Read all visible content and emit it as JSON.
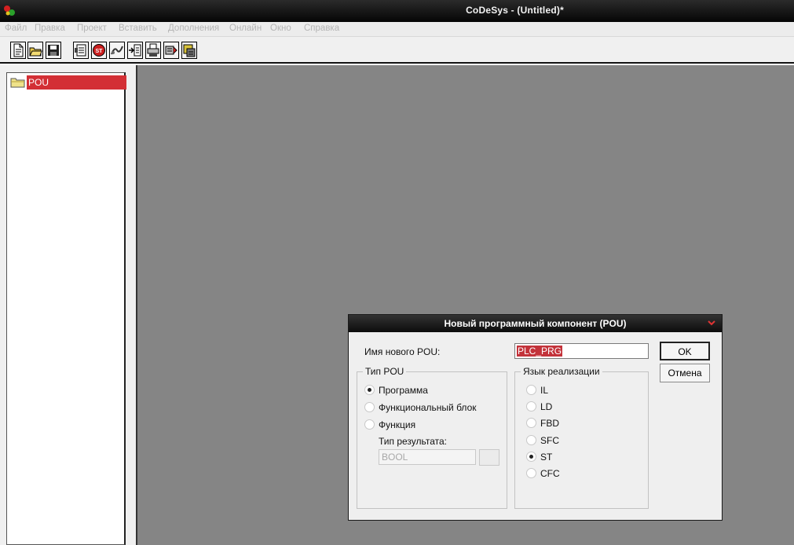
{
  "window": {
    "title": "CoDeSys - (Untitled)*"
  },
  "menu": [
    {
      "label": "Файл"
    },
    {
      "label": "Правка"
    },
    {
      "label": "Проект"
    },
    {
      "label": "Вставить"
    },
    {
      "label": "Дополнения"
    },
    {
      "label": "Онлайн"
    },
    {
      "label": "Окно"
    },
    {
      "label": "Справка"
    }
  ],
  "toolbar": {
    "icons": [
      "new-file-icon",
      "open-folder-icon",
      "save-icon",
      "pou-icon",
      "stop-icon",
      "connect-icon",
      "step-icon",
      "print-icon",
      "login-icon",
      "download-icon"
    ]
  },
  "tree": {
    "root_label": "POU"
  },
  "dialog": {
    "title": "Новый программный компонент (POU)",
    "name_label": "Имя нового POU:",
    "name_value": "PLC_PRG",
    "ok_label": "OK",
    "cancel_label": "Отмена",
    "pou_type": {
      "title": "Тип POU",
      "options": [
        {
          "label": "Программа",
          "selected": true
        },
        {
          "label": "Функциональный блок",
          "selected": false
        },
        {
          "label": "Функция",
          "selected": false
        }
      ],
      "result_type_label": "Тип результата:",
      "result_type_value": "BOOL"
    },
    "language": {
      "title": "Язык реализации",
      "options": [
        {
          "label": "IL",
          "selected": false
        },
        {
          "label": "LD",
          "selected": false
        },
        {
          "label": "FBD",
          "selected": false
        },
        {
          "label": "SFC",
          "selected": false
        },
        {
          "label": "ST",
          "selected": true
        },
        {
          "label": "CFC",
          "selected": false
        }
      ]
    }
  },
  "colors": {
    "selection": "#d32f35",
    "workspace": "#858585"
  }
}
